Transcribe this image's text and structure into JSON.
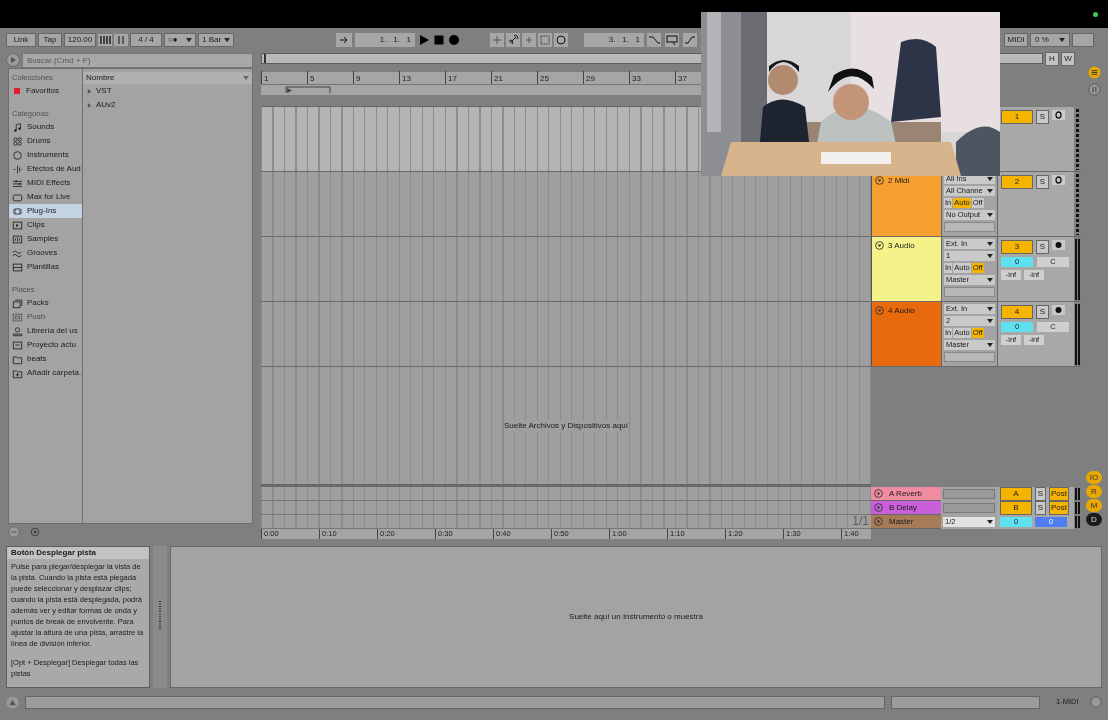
{
  "transport": {
    "link": "Link",
    "tap": "Tap",
    "tempo": "120.00",
    "signature": "4 / 4",
    "metronome": "○●",
    "quantize": "1 Bar",
    "position": "1.   1.   1",
    "loop_start": "3.   1.   1",
    "midi": "MIDI",
    "cpu": "0 %"
  },
  "browser": {
    "search_placeholder": "Buscar (Cmd + F)",
    "sections": [
      {
        "title": "Colecciones",
        "items": [
          {
            "kind": "tag",
            "label": "Favoritos",
            "color": "#e0202a",
            "selected": false
          }
        ]
      },
      {
        "title": "Categorías",
        "items": [
          {
            "kind": "sounds",
            "label": "Sounds",
            "selected": false
          },
          {
            "kind": "drums",
            "label": "Drums",
            "selected": false
          },
          {
            "kind": "instruments",
            "label": "Instruments",
            "selected": false
          },
          {
            "kind": "effects",
            "label": "Efectos de Aud",
            "selected": false
          },
          {
            "kind": "midi",
            "label": "MIDI Effects",
            "selected": false
          },
          {
            "kind": "max",
            "label": "Max for Live",
            "selected": false
          },
          {
            "kind": "plugins",
            "label": "Plug-Ins",
            "selected": true
          },
          {
            "kind": "clips",
            "label": "Clips",
            "selected": false
          },
          {
            "kind": "samples",
            "label": "Samples",
            "selected": false
          },
          {
            "kind": "grooves",
            "label": "Grooves",
            "selected": false
          },
          {
            "kind": "templates",
            "label": "Plantillas",
            "selected": false
          }
        ]
      },
      {
        "title": "Places",
        "items": [
          {
            "kind": "packs",
            "label": "Packs",
            "selected": false,
            "disabled": false
          },
          {
            "kind": "push",
            "label": "Push",
            "selected": false,
            "disabled": true
          },
          {
            "kind": "user",
            "label": "Librería del us",
            "selected": false,
            "disabled": false
          },
          {
            "kind": "project",
            "label": "Proyecto actu",
            "selected": false,
            "disabled": false
          },
          {
            "kind": "folder",
            "label": "beats",
            "selected": false,
            "disabled": false
          },
          {
            "kind": "add",
            "label": "Añadir carpeta.",
            "selected": false,
            "disabled": false
          }
        ]
      }
    ],
    "column": "Nombre",
    "entries": [
      {
        "label": "VST",
        "expanded": false
      },
      {
        "label": "AUv2",
        "expanded": false
      }
    ]
  },
  "overview": {
    "buttons": [
      "H",
      "W"
    ]
  },
  "arrangement": {
    "bars": [
      "1",
      "5",
      "9",
      "13",
      "17",
      "21",
      "25",
      "29",
      "33",
      "37"
    ],
    "times": [
      "0:00",
      "0:10",
      "0:20",
      "0:30",
      "0:40",
      "0:50",
      "1:00",
      "1:10",
      "1:20",
      "1:30",
      "1:40"
    ],
    "drop_hint": "Suelte Archivos y Dispositivos aquí",
    "zoom": "1/1"
  },
  "tracks": [
    {
      "kind": "midi",
      "number": "1",
      "solo": "S",
      "selected": true
    },
    {
      "kind": "midi",
      "name": "2 Midi",
      "color": "#f5a031",
      "input": "All Ins",
      "channel": "All Channe",
      "monitor": [
        {
          "label": "In",
          "selected": false
        },
        {
          "label": "Auto",
          "selected": true
        },
        {
          "label": "Off",
          "selected": false
        }
      ],
      "output": "No Output",
      "number": "2",
      "solo": "S",
      "selected": false
    },
    {
      "kind": "audio",
      "name": "3 Audio",
      "color": "#f6f28a",
      "input": "Ext. In",
      "channel": "1",
      "monitor": [
        {
          "label": "In",
          "selected": false
        },
        {
          "label": "Auto",
          "selected": false
        },
        {
          "label": "Off",
          "selected": true
        }
      ],
      "output": "Master",
      "number": "3",
      "solo": "S",
      "volume": "0",
      "pan": "C",
      "peak_left": "-inf",
      "peak_right": "-inf",
      "selected": false
    },
    {
      "kind": "audio",
      "name": "4 Audio",
      "color": "#e9690f",
      "input": "Ext. In",
      "channel": "2",
      "monitor": [
        {
          "label": "In",
          "selected": false
        },
        {
          "label": "Auto",
          "selected": false
        },
        {
          "label": "Off",
          "selected": true
        }
      ],
      "output": "Master",
      "number": "4",
      "solo": "S",
      "volume": "0",
      "pan": "C",
      "peak_left": "-inf",
      "peak_right": "-inf",
      "selected": false
    }
  ],
  "returns": [
    {
      "kind": "return",
      "name": "A Reverb",
      "color": "#f08ca2",
      "letter": "A",
      "solo": "S",
      "post": "Post"
    },
    {
      "kind": "return",
      "name": "B Delay",
      "color": "#c860dc",
      "letter": "B",
      "solo": "S",
      "post": "Post"
    },
    {
      "kind": "master",
      "name": "Master",
      "color": "#a87b57",
      "output": "1/2",
      "cue": "0",
      "volume": "0"
    }
  ],
  "side_buttons": [
    {
      "label": "IO",
      "on": true
    },
    {
      "label": "R",
      "on": true
    },
    {
      "label": "M",
      "on": true
    },
    {
      "label": "D",
      "on": false
    }
  ],
  "info": {
    "title": "Botón Desplegar pista",
    "body": "Pulse para plegar/desplegar la vista de la pista. Cuando la pista está plegada puede seleccionar y desplazar clips; cuando la pista está desplegada, podrá además ver y editar formas de onda y puntos de break de envolvente. Para ajustar la altura de una pista, arrastre la línea de división inferior.",
    "shortcut": "[Opt + Desplegar] Desplegar todas las pistas"
  },
  "device_hint": "Suelte aquí un Instrumento o muestra",
  "status": {
    "track": "1-MIDI"
  }
}
